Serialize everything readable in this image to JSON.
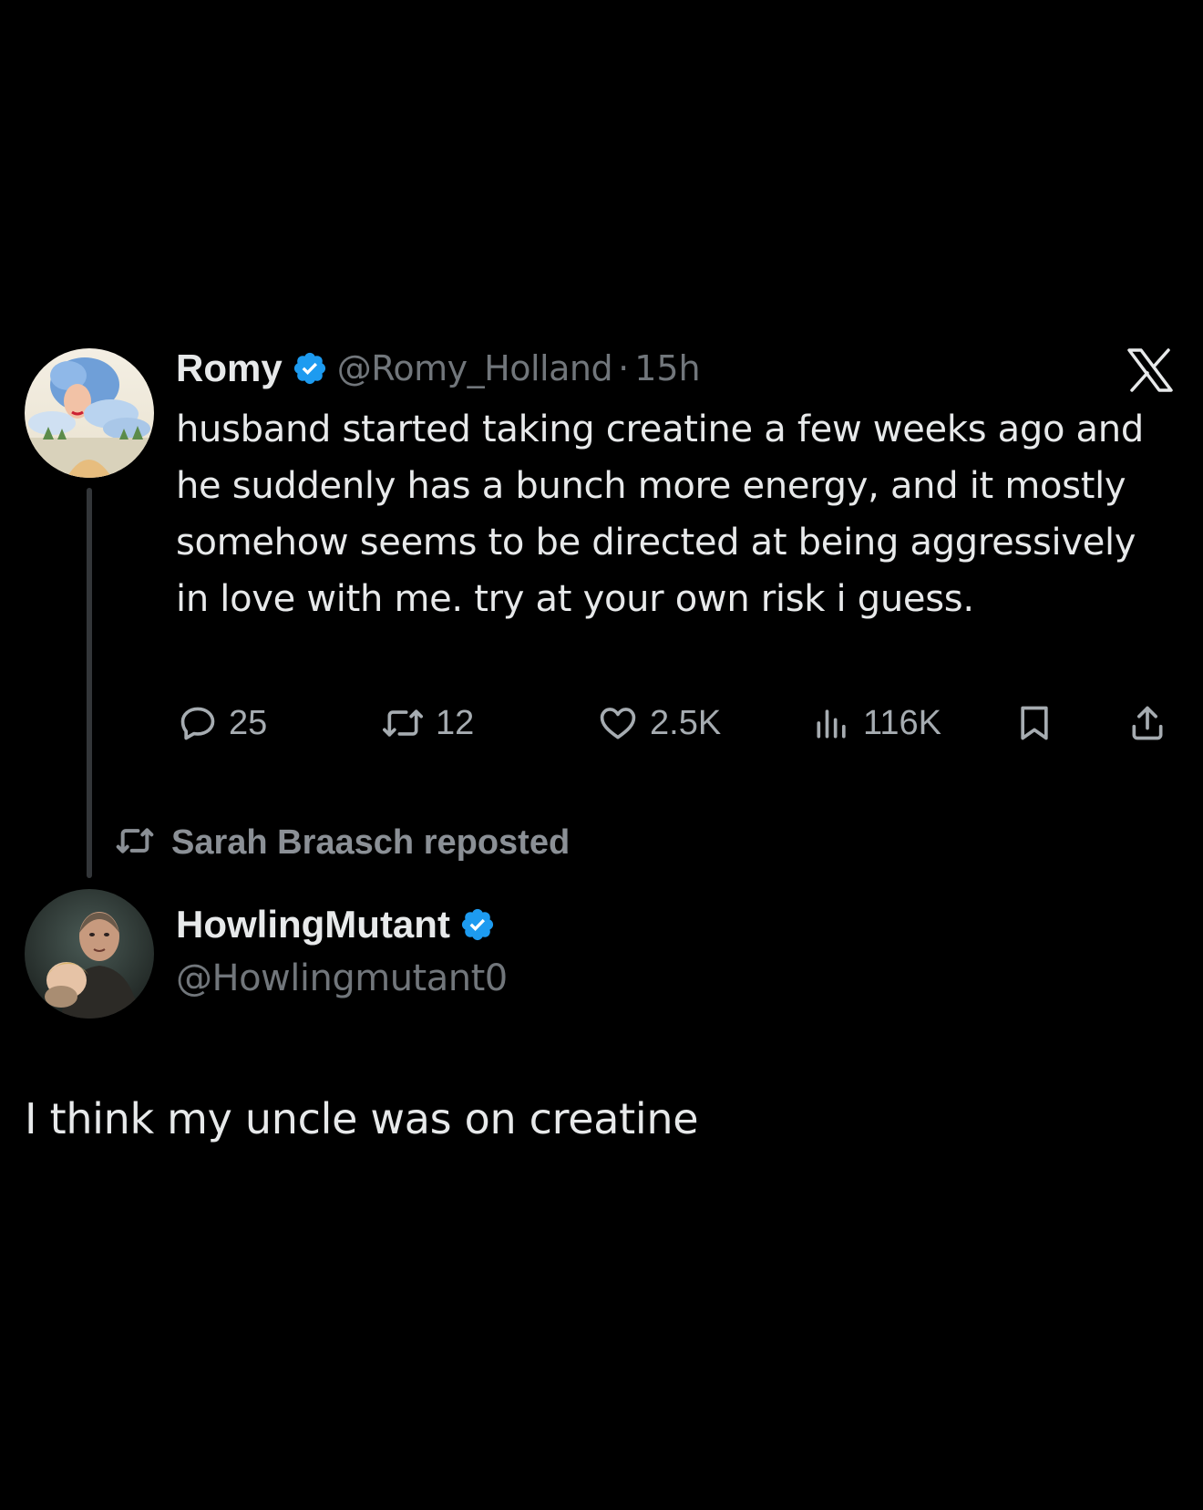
{
  "quoted_tweet": {
    "display_name": "Romy",
    "handle": "@Romy_Holland",
    "separator": "·",
    "time": "15h",
    "text": "husband started taking creatine a few weeks ago and he suddenly has a bunch more energy, and it mostly somehow seems to be directed at being aggressively in love with me. try at your own risk i guess.",
    "stats": {
      "replies": "25",
      "reposts": "12",
      "likes": "2.5K",
      "views": "116K"
    }
  },
  "repost_bar": {
    "text": "Sarah Braasch reposted"
  },
  "reply_tweet": {
    "display_name": "HowlingMutant",
    "handle": "@Howlingmutant0",
    "text": "I think my uncle was on creatine"
  },
  "icons": {
    "verified": "verified-badge-icon",
    "brand": "x-logo-icon",
    "reply": "reply-bubble-icon",
    "repost": "repost-icon",
    "like": "heart-icon",
    "views": "views-bar-chart-icon",
    "bookmark": "bookmark-icon",
    "share": "share-icon"
  },
  "colors": {
    "background": "#000000",
    "text_primary": "#e7e9ea",
    "text_secondary": "#71767b",
    "verified_blue": "#1d9bf0",
    "thread_line": "#333639"
  }
}
